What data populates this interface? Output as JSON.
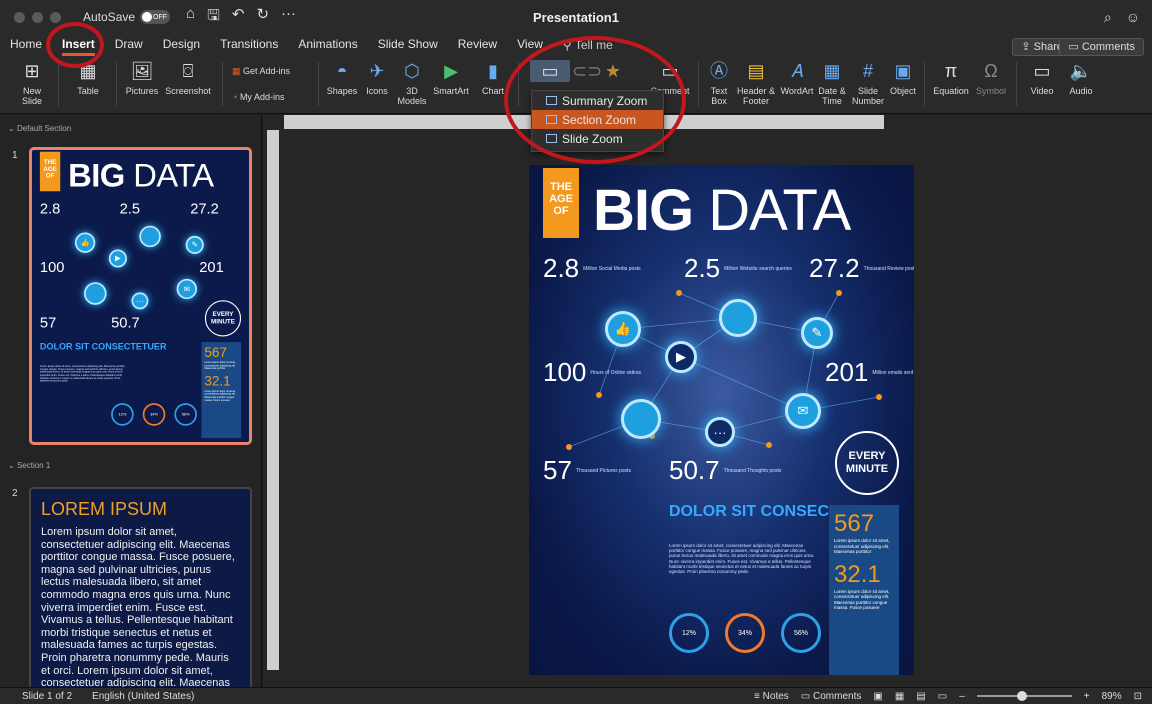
{
  "titlebar": {
    "autosave_label": "AutoSave",
    "autosave_state": "OFF",
    "doc_title": "Presentation1",
    "home_icon": "home-icon",
    "save_icon": "save-icon",
    "undo_icon": "undo-icon",
    "redo_icon": "redo-icon",
    "more_icon": "more-icon"
  },
  "tabs": [
    "Home",
    "Insert",
    "Draw",
    "Design",
    "Transitions",
    "Animations",
    "Slide Show",
    "Review",
    "View"
  ],
  "active_tab": "Insert",
  "tell_me": "Tell me",
  "share_label": "Share",
  "comments_label": "Comments",
  "ribbon": {
    "new_slide": "New Slide",
    "table": "Table",
    "pictures": "Pictures",
    "screenshot": "Screenshot",
    "get_addins": "Get Add-ins",
    "my_addins": "My Add-ins",
    "shapes": "Shapes",
    "icons": "Icons",
    "models_3d": "3D Models",
    "smartart": "SmartArt",
    "chart": "Chart",
    "comment": "Comment",
    "text_box": "Text Box",
    "header_footer": "Header & Footer",
    "wordart": "WordArt",
    "date_time": "Date & Time",
    "slide_number": "Slide Number",
    "object": "Object",
    "equation": "Equation",
    "symbol": "Symbol",
    "video": "Video",
    "audio": "Audio"
  },
  "zoom_menu": {
    "items": [
      "Summary Zoom",
      "Section Zoom",
      "Slide Zoom"
    ],
    "selected": "Section Zoom"
  },
  "sections": {
    "default": "Default Section",
    "section1": "Section 1"
  },
  "slide_numbers": [
    "1",
    "2"
  ],
  "slide2": {
    "title": "LOREM IPSUM",
    "body": "Lorem ipsum dolor sit amet, consectetuer adipiscing elit. Maecenas porttitor congue massa. Fusce posuere, magna sed pulvinar ultricies, purus lectus malesuada libero, sit amet commodo magna eros quis urna. Nunc viverra imperdiet enim. Fusce est. Vivamus a tellus. Pellentesque habitant morbi tristique senectus et netus et malesuada fames ac turpis egestas. Proin pharetra nonummy pede. Mauris et orci. Lorem ipsum dolor sit amet, consectetuer adipiscing elit. Maecenas porttitor congue massa. Fusce posuere, magna sed pulvinar ultricies, purus lectus malesuada libero, sit amet"
  },
  "infographic": {
    "tag": "THE AGE OF",
    "title_bold": "BIG",
    "title_light": "DATA",
    "stats": [
      {
        "value": "2.8",
        "note": "Million Social Media posts"
      },
      {
        "value": "2.5",
        "note": "Million Website search queries"
      },
      {
        "value": "27.2",
        "note": "Thousand Review posts"
      },
      {
        "value": "100",
        "note": "Hours of Online videos"
      },
      {
        "value": "201",
        "note": "Million emails sent"
      },
      {
        "value": "57",
        "note": "Thousand Pictures posts"
      },
      {
        "value": "50.7",
        "note": "Thousand Thoughts posts"
      }
    ],
    "every_minute": "EVERY MINUTE",
    "dolor_title": "DOLOR SIT CONSECTETUER",
    "dolor_body": "Lorem ipsum dolor sit amet, consectetuer adipiscing elit. Maecenas porttitor congue massa. Fusce posuere, magna sed pulvinar ultricies, purus lectus malesuada libero, sit amet commodo magna eros quis urna. Nunc viverra imperdiet enim. Fusce est. Vivamus a tellus. Pellentesque habitant morbi tristique senectus et netus et malesuada fames ac turpis egestas. Proin pharetra nonummy pede.",
    "box_num1": "567",
    "box_text1": "Lorem ipsum dolor sit amet, consectetuer adipiscing elit. Maecenas porttitor",
    "box_num2": "32.1",
    "box_text2": "Lorem ipsum dolor sit amet, consectetuer adipiscing elit. Maecenas porttitor congue massa. Fusce posuere",
    "gauges": [
      "12%",
      "34%",
      "56%"
    ]
  },
  "statusbar": {
    "slide_info": "Slide 1 of 2",
    "language": "English (United States)",
    "notes": "Notes",
    "comments": "Comments",
    "zoom": "89%"
  },
  "colors": {
    "accent_tab": "#e25b2c",
    "highlight_circle": "#c2171c",
    "slide_bg": "#0a1848",
    "orange": "#f39a1e"
  }
}
